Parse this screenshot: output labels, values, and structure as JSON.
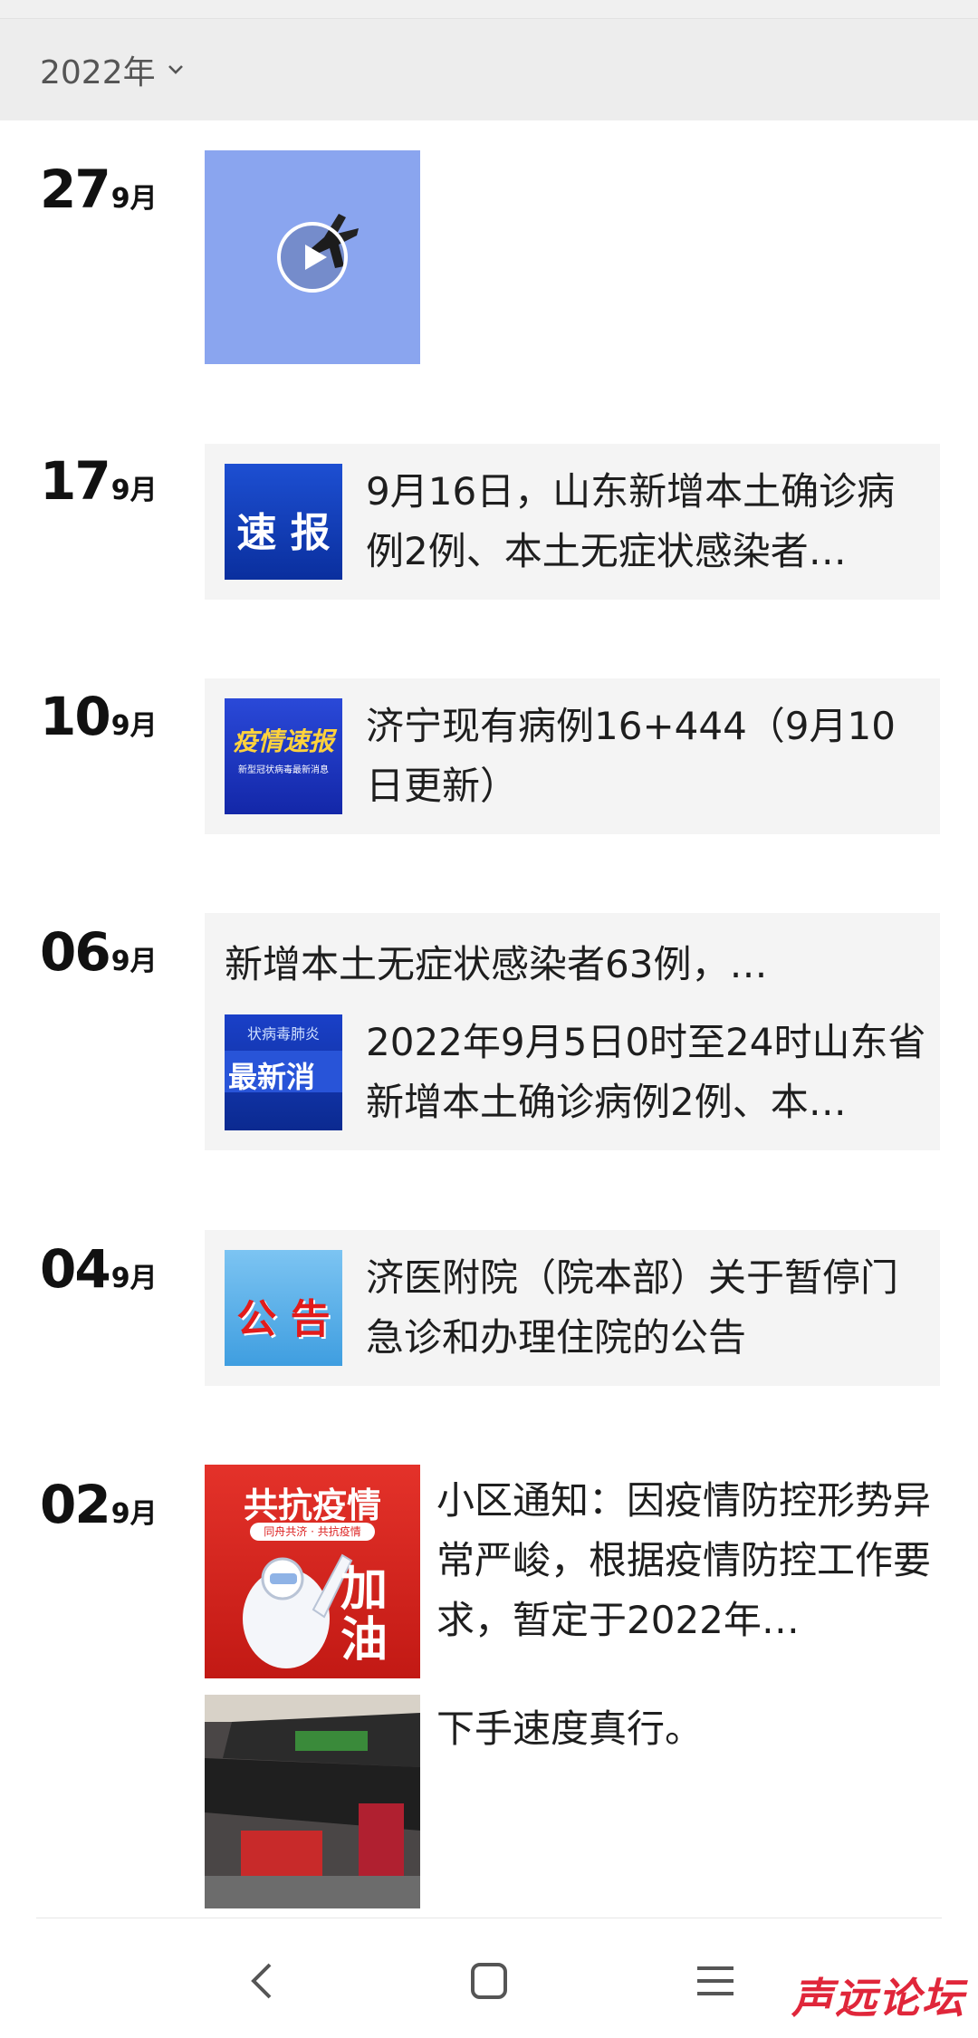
{
  "header": {
    "year_label": "2022年"
  },
  "posts": [
    {
      "day": "27",
      "month": "9月"
    },
    {
      "day": "17",
      "month": "9月",
      "title": "9月16日，山东新增本土确诊病例2例、本土无症状感染者…",
      "thumb_text": "速 报"
    },
    {
      "day": "10",
      "month": "9月",
      "title": "济宁现有病例16+444（9月10日更新）",
      "thumb_text": "疫情速报",
      "thumb_sub": "新型冠状病毒最新消息"
    },
    {
      "day": "06",
      "month": "9月",
      "headline": "新增本土无症状感染者63例，…",
      "title": "2022年9月5日0时至24时山东省新增本土确诊病例2例、本…",
      "thumb_text_top": "状病毒肺炎",
      "thumb_text": "最新消"
    },
    {
      "day": "04",
      "month": "9月",
      "title": "济医附院（院本部）关于暂停门急诊和办理住院的公告",
      "thumb_text": "公 告"
    },
    {
      "day": "02",
      "month": "9月",
      "title": "小区通知：因疫情防控形势异常严峻，根据疫情防控工作要求，暂定于2022年…",
      "thumb_text": "共抗疫情",
      "thumb_sub": "同舟共济 · 共抗疫情",
      "thumb_big": "加油",
      "title2": "下手速度真行。"
    }
  ],
  "watermark": "声远论坛"
}
